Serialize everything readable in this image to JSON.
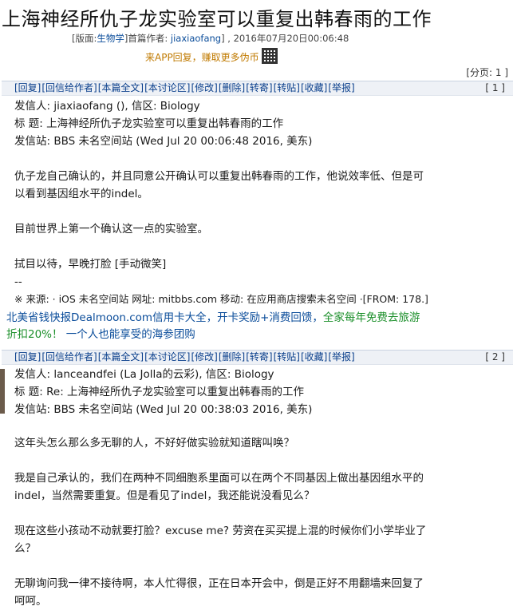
{
  "title": "上海神经所仇子龙实验室可以重复出韩春雨的工作",
  "meta": {
    "board_prefix": "[版面:",
    "board": "生物学",
    "board_suffix": "]首篇作者: ",
    "author": "jiaxiaofang",
    "date": "] , 2016年07月20日00:06:48"
  },
  "app_promo": "来APP回复，赚取更多伪币",
  "page_count": "[分页: 1 ]",
  "post_actions": [
    "[回复]",
    "[回信给作者]",
    "[本篇全文]",
    "[本讨论区]",
    "[修改]",
    "[删除]",
    "[转寄]",
    "[转贴]",
    "[收藏]",
    "[举报]"
  ],
  "posts": [
    {
      "floor": "[ 1 ]",
      "sender": "发信人: jiaxiaofang (), 信区: Biology",
      "subject": "标  题: 上海神经所仇子龙实验室可以重复出韩春雨的工作",
      "site": "发信站: BBS 未名空间站 (Wed Jul 20 00:06:48 2016, 美东)",
      "body": [
        "仇子龙自己确认的，并且同意公开确认可以重复出韩春雨的工作，他说效率低、但是可",
        "以看到基因组水平的indel。",
        "",
        "目前世界上第一个确认这一点的实验室。",
        "",
        "拭目以待，早晚打脸 [手动微笑]",
        "--",
        "※ 来源: · iOS 未名空间站 网址: mitbbs.com 移动: 在应用商店搜索未名空间 ·[FROM: 178.]"
      ]
    },
    {
      "floor": "[ 2 ]",
      "sender": "发信人: lanceandfei (La Jolla的云彩), 信区: Biology",
      "subject": "标  题: Re: 上海神经所仇子龙实验室可以重复出韩春雨的工作",
      "site": "发信站: BBS 未名空间站 (Wed Jul 20 00:38:03 2016, 美东)",
      "body": [
        "这年头怎么那么多无聊的人，不好好做实验就知道瞎叫唤？",
        "",
        "我是自己承认的，我们在两种不同细胞系里面可以在两个不同基因上做出基因组水平的",
        "indel，当然需要重复。但是看见了indel，我还能说没看见么？",
        "",
        "现在这些小孩动不动就要打脸？excuse me? 劳资在买买提上混的时候你们小学毕业了",
        "么？",
        "",
        "无聊询问我一律不接待啊，本人忙得很，正在日本开会中，倒是正好不用翻墙来回复了",
        "呵呵。"
      ]
    }
  ],
  "ad": {
    "line1_a": "北美省钱快报Dealmoon.com信用卡大全，开卡奖励+消费回馈，",
    "line1_b": "全家每年免费去旅游",
    "line2_a": "折扣20%！",
    "line2_b": " 一个人也能享受的海参团购"
  }
}
